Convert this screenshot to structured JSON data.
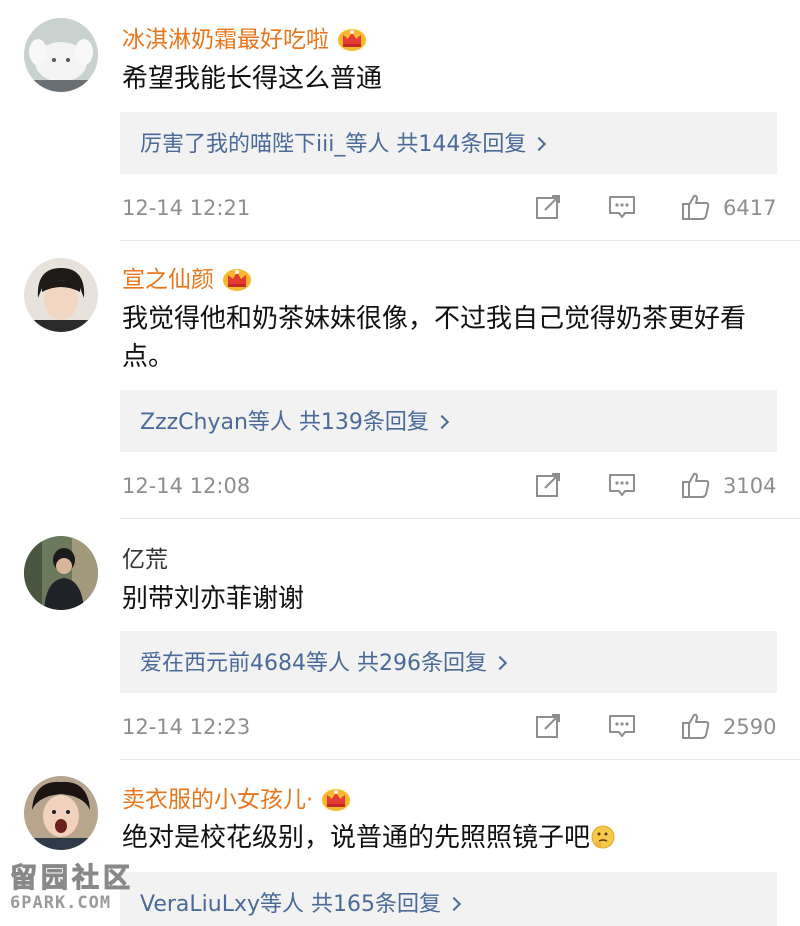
{
  "comments": [
    {
      "username": "冰淇淋奶霜最好吃啦",
      "is_vip": true,
      "text": "希望我能长得这么普通",
      "reply_summary": "厉害了我的喵陛下iii_等人  共144条回复",
      "time": "12-14 12:21",
      "likes": "6417"
    },
    {
      "username": "宣之仙颜",
      "is_vip": true,
      "text": "我觉得他和奶茶妹妹很像，不过我自己觉得奶茶更好看点。",
      "reply_summary": "ZzzChyan等人  共139条回复",
      "time": "12-14 12:08",
      "likes": "3104"
    },
    {
      "username": "亿荒",
      "is_vip": false,
      "text": "别带刘亦菲谢谢",
      "reply_summary": "爱在西元前4684等人  共296条回复",
      "time": "12-14 12:23",
      "likes": "2590"
    },
    {
      "username": "卖衣服的小女孩儿·",
      "is_vip": true,
      "text": "绝对是校花级别，说普通的先照照镜子吧",
      "reply_summary": "VeraLiuLxy等人  共165条回复"
    }
  ],
  "watermark": {
    "chars": "留园社区",
    "url": "6PARK.COM"
  },
  "colors": {
    "username_vip": "#e8761d",
    "reply_link": "#4a6a9a",
    "meta_gray": "#8e8e8e",
    "reply_bg": "#f2f2f2",
    "crown_gold": "#f5b82e"
  },
  "icons": {
    "crown": "crown-badge-icon",
    "share": "share-edit-icon",
    "comment": "comment-bubble-icon",
    "like": "thumbs-up-icon",
    "emoji": "thinking-face-emoji-icon"
  }
}
